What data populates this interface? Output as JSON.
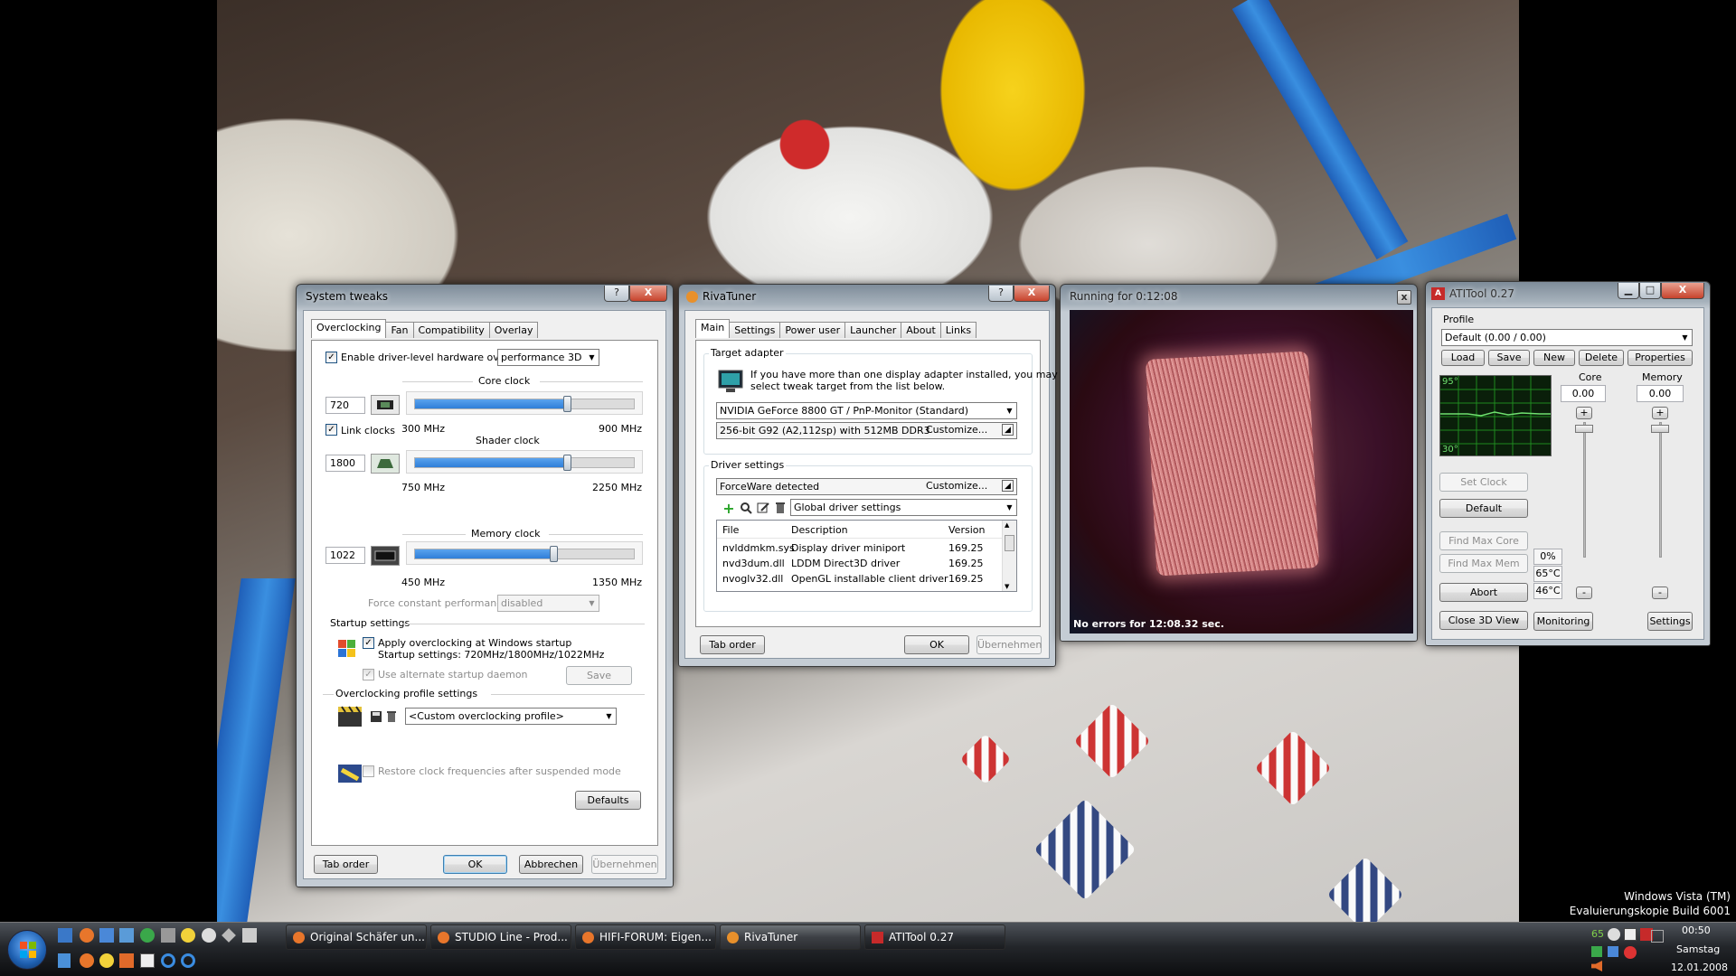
{
  "desktop": {
    "watermark_line1": "Windows Vista (TM)",
    "watermark_line2": "Evaluierungskopie Build 6001"
  },
  "system_tweaks": {
    "title": "System tweaks",
    "help": "?",
    "close": "X",
    "tabs": [
      "Overclocking",
      "Fan",
      "Compatibility",
      "Overlay"
    ],
    "enable_label": "Enable driver-level hardware overclocking",
    "enable_checked": true,
    "mode": "performance 3D",
    "core_clock": {
      "label": "Core clock",
      "value": "720",
      "min": "300 MHz",
      "max": "900 MHz",
      "level": 0.7
    },
    "link_clocks": "Link clocks",
    "shader_clock": {
      "label": "Shader clock",
      "value": "1800",
      "min": "750 MHz",
      "max": "2250 MHz",
      "level": 0.7
    },
    "memory_clock": {
      "label": "Memory clock",
      "value": "1022",
      "min": "450 MHz",
      "max": "1350 MHz",
      "level": 0.635
    },
    "force_label": "Force constant performance level",
    "force_value": "disabled",
    "startup_settings": "Startup settings",
    "apply_label": "Apply overclocking at Windows startup",
    "startup_detail": "Startup settings: 720MHz/1800MHz/1022MHz",
    "alt_daemon": "Use alternate startup daemon",
    "save": "Save",
    "profile_settings": "Overclocking profile settings",
    "profile_value": "<Custom overclocking profile>",
    "restore_label": "Restore clock frequencies after suspended mode",
    "defaults": "Defaults",
    "tab_order": "Tab order",
    "ok": "OK",
    "cancel": "Abbrechen",
    "apply": "Übernehmen"
  },
  "rivatuner": {
    "title": "RivaTuner",
    "help": "?",
    "close": "X",
    "tabs": [
      "Main",
      "Settings",
      "Power user",
      "Launcher",
      "About",
      "Links"
    ],
    "target_adapter": "Target adapter",
    "info_line1": "If you have more than one display adapter installed, you may",
    "info_line2": "select tweak target from the list below.",
    "adapter": "NVIDIA GeForce 8800 GT / PnP-Monitor (Standard)",
    "adapter_info": "256-bit G92 (A2,112sp) with 512MB DDR3",
    "customize": "Customize...",
    "driver_settings": "Driver settings",
    "forceware": "ForceWare detected",
    "global": "Global driver settings",
    "columns": [
      "File",
      "Description",
      "Version"
    ],
    "rows": [
      {
        "file": "nvlddmkm.sys",
        "desc": "Display driver miniport",
        "ver": "169.25"
      },
      {
        "file": "nvd3dum.dll",
        "desc": "LDDM Direct3D driver",
        "ver": "169.25"
      },
      {
        "file": "nvoglv32.dll",
        "desc": "OpenGL installable client driver",
        "ver": "169.25"
      }
    ],
    "tab_order": "Tab order",
    "ok": "OK",
    "apply": "Übernehmen"
  },
  "fur": {
    "title": "Running for 0:12:08",
    "status": "No errors for 12:08.32 sec."
  },
  "atitool": {
    "title": "ATITool 0.27",
    "profile_label": "Profile",
    "profile": "Default (0.00 / 0.00)",
    "load": "Load",
    "save": "Save",
    "new": "New",
    "delete": "Delete",
    "properties": "Properties",
    "temp_high": "95°",
    "temp_low": "30°",
    "core_label": "Core",
    "memory_label": "Memory",
    "core_value": "0.00",
    "memory_value": "0.00",
    "plus": "+",
    "minus": "-",
    "set_clock": "Set Clock",
    "default": "Default",
    "find_max_core": "Find Max Core",
    "find_max_mem": "Find Max Mem",
    "abort": "Abort",
    "close3d": "Close 3D View",
    "monitoring": "Monitoring",
    "settings": "Settings",
    "load_pct": "0%",
    "temp1": "65°C",
    "temp2": "46°C"
  },
  "taskbar": {
    "buttons": [
      "Original Schäfer un...",
      "STUDIO Line - Prod...",
      "HIFI-FORUM: Eigen...",
      "RivaTuner",
      "ATITool 0.27"
    ],
    "tray_number": "65",
    "time": "00:50",
    "day": "Samstag",
    "date": "12.01.2008"
  },
  "colors": {
    "slider_fill": "#2f7ed8",
    "fur": "#c87070",
    "graph_bg": "#0a1f0a",
    "graph_grid": "#1f8a1f"
  }
}
